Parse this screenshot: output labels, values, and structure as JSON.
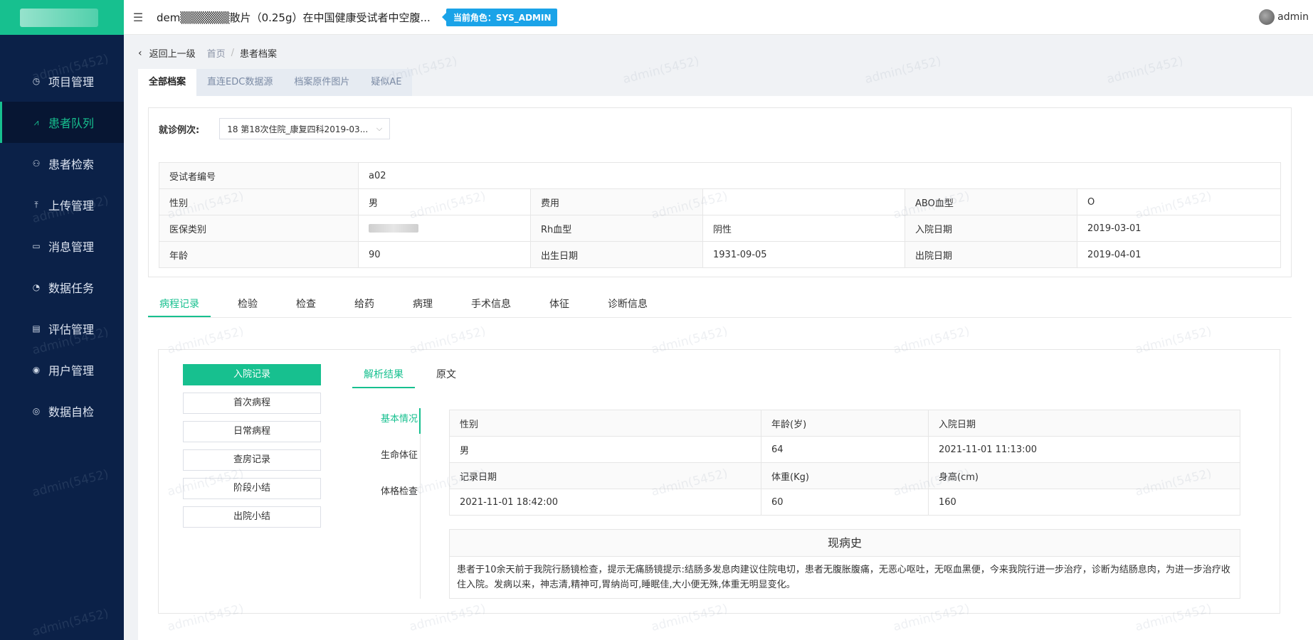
{
  "header": {
    "project_title": "dem▒▒▒▒▒▒散片（0.25g）在中国健康受试者中空腹...",
    "role_badge": "当前角色：SYS_ADMIN",
    "username": "admin",
    "menu_icon": "hamburger-icon"
  },
  "sidebar": {
    "items": [
      {
        "label": "项目管理",
        "icon": "clock-icon"
      },
      {
        "label": "患者队列",
        "icon": "cohort-icon"
      },
      {
        "label": "患者检索",
        "icon": "users-search-icon"
      },
      {
        "label": "上传管理",
        "icon": "upload-icon"
      },
      {
        "label": "消息管理",
        "icon": "message-icon"
      },
      {
        "label": "数据任务",
        "icon": "task-icon"
      },
      {
        "label": "评估管理",
        "icon": "clipboard-icon"
      },
      {
        "label": "用户管理",
        "icon": "user-icon"
      },
      {
        "label": "数据自检",
        "icon": "check-icon"
      }
    ]
  },
  "breadcrumb": {
    "back": "返回上一级",
    "home": "首页",
    "separator": "/",
    "current": "患者档案"
  },
  "top_tabs": [
    "全部档案",
    "直连EDC数据源",
    "档案原件图片",
    "疑似AE"
  ],
  "visit": {
    "label": "就诊例次:",
    "selected": "18 第18次住院_康复四科2019-03..."
  },
  "patient": {
    "subject_id_label": "受试者编号",
    "subject_id": "a02",
    "gender_label": "性别",
    "gender": "男",
    "fee_label": "费用",
    "fee": "",
    "abo_label": "ABO血型",
    "abo": "O",
    "insurance_label": "医保类别",
    "rh_label": "Rh血型",
    "rh": "阴性",
    "admit_label": "入院日期",
    "admit": "2019-03-01",
    "age_label": "年龄",
    "age": "90",
    "birth_label": "出生日期",
    "birth": "1931-09-05",
    "discharge_label": "出院日期",
    "discharge": "2019-04-01"
  },
  "sub_tabs": [
    "病程记录",
    "检验",
    "检查",
    "给药",
    "病理",
    "手术信息",
    "体征",
    "诊断信息"
  ],
  "records": [
    "入院记录",
    "首次病程",
    "日常病程",
    "查房记录",
    "阶段小结",
    "出院小结"
  ],
  "result_tabs": [
    "解析结果",
    "原文"
  ],
  "sections": [
    "基本情况",
    "生命体征",
    "体格检查"
  ],
  "vitals": {
    "gender_label": "性别",
    "age_label": "年龄(岁)",
    "admit_label": "入院日期",
    "gender": "男",
    "age": "64",
    "admit": "2021-11-01 11:13:00",
    "record_label": "记录日期",
    "weight_label": "体重(Kg)",
    "height_label": "身高(cm)",
    "record": "2021-11-01 18:42:00",
    "weight": "60",
    "height": "160"
  },
  "hpi": {
    "title": "现病史",
    "text": "患者于10余天前于我院行肠镜检查，提示无痛肠镜提示:结肠多发息肉建议住院电切，患者无腹胀腹痛，无恶心呕吐，无呕血黑便，今来我院行进一步治疗，诊断为结肠息肉，为进一步治疗收住入院。发病以来，神志清,精神可,胃纳尚可,睡眠佳,大小便无殊,体重无明显变化。"
  },
  "watermark": "admin(5452)",
  "colors": {
    "accent": "#17c08f",
    "sidebar": "#0b2148",
    "badge": "#1aa3e8"
  }
}
